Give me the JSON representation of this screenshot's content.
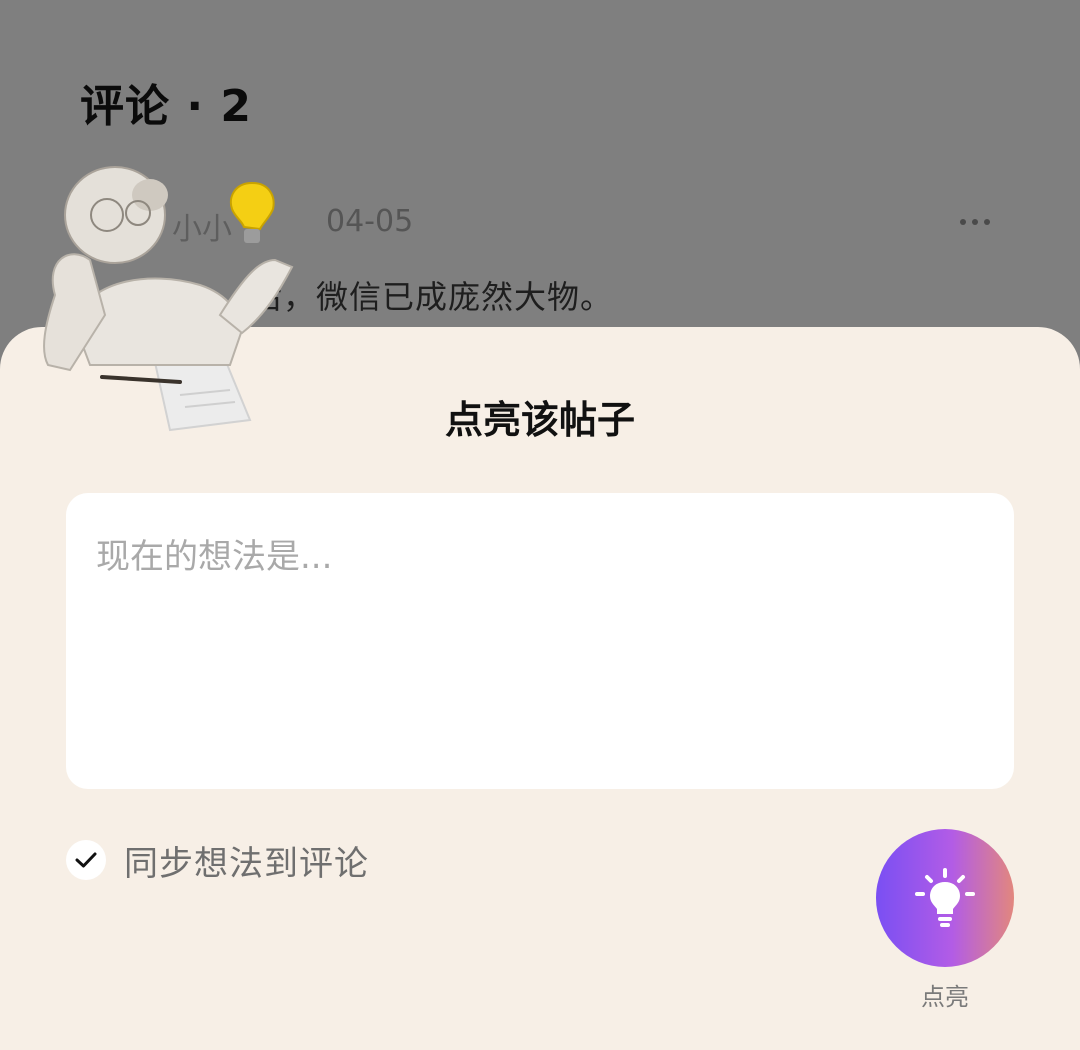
{
  "comments": {
    "title": "评论 · 2",
    "items": [
      {
        "author": "小小",
        "time": "04-05",
        "text": "后，微信已成庞然大物。"
      }
    ]
  },
  "sheet": {
    "title": "点亮该帖子",
    "input_placeholder": "现在的想法是...",
    "sync_label": "同步想法到评论",
    "sync_checked": true,
    "light_button_label": "点亮"
  },
  "icons": {
    "more": "more-icon",
    "check": "check-icon",
    "bulb": "lightbulb-icon",
    "illustration": "robot-with-lightbulb-illustration"
  },
  "colors": {
    "overlay": "#7f7f7f",
    "sheet_bg": "#f7efe6",
    "button_gradient_start": "#7a4ff3",
    "button_gradient_end": "#e2877e"
  }
}
